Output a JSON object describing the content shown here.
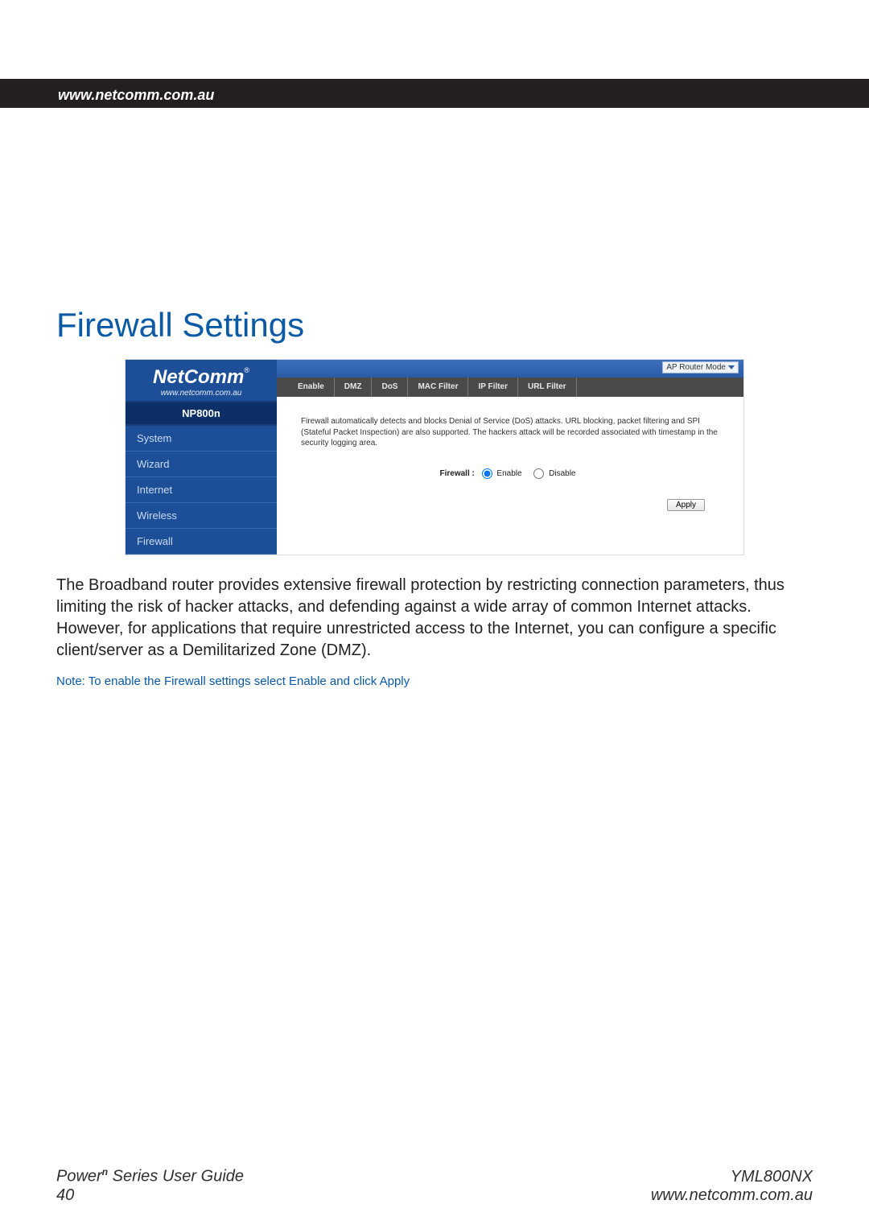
{
  "header": {
    "brand": "NetComm",
    "url": "www.netcomm.com.au"
  },
  "section_title": "Firewall Settings",
  "screenshot": {
    "sidebar": {
      "brand": "NetComm",
      "url": "www.netcomm.com.au",
      "model": "NP800n",
      "nav": [
        "System",
        "Wizard",
        "Internet",
        "Wireless",
        "Firewall"
      ]
    },
    "mode_select": "AP Router Mode",
    "tabs": [
      "Enable",
      "DMZ",
      "DoS",
      "MAC Filter",
      "IP Filter",
      "URL Filter"
    ],
    "description": "Firewall automatically detects and blocks Denial of Service (DoS) attacks. URL blocking, packet filtering and SPI (Stateful Packet Inspection) are also supported. The hackers attack will be recorded associated with timestamp in the security logging area.",
    "radio_label": "Firewall :",
    "radio_enable": "Enable",
    "radio_disable": "Disable",
    "apply": "Apply"
  },
  "body_paragraph": "The Broadband router provides extensive firewall protection by restricting connection parameters, thus limiting the risk of hacker attacks, and defending against a wide array of common Internet attacks. However, for applications that require unrestricted access to the Internet, you can configure a specific client/server as a Demilitarized Zone (DMZ).",
  "note": "Note: To enable the Firewall settings select Enable and click Apply",
  "footer": {
    "left_line1_pre": "Power",
    "left_line1_sup": "n",
    "left_line1_post": " Series User Guide",
    "page_number": "40",
    "right_line1": "YML800NX",
    "right_line2": "www.netcomm.com.au"
  }
}
